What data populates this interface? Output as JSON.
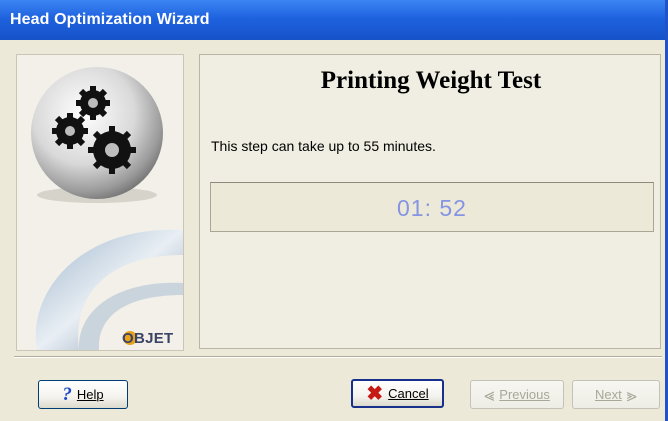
{
  "window": {
    "title": "Head Optimization Wizard"
  },
  "sidebar": {
    "logo_text": "OBJET"
  },
  "step": {
    "title": "Printing Weight Test",
    "description": "This step can take up to 55 minutes.",
    "timer": "01: 52"
  },
  "buttons": {
    "help": "Help",
    "cancel": "Cancel",
    "previous": "Previous",
    "next": "Next"
  },
  "colors": {
    "titlebar": "#1f62df",
    "timer_text": "#8594e3",
    "cancel_icon": "#c51a16",
    "help_icon": "#1b49c8"
  },
  "icons": {
    "help": "question-mark-icon",
    "cancel": "red-x-icon",
    "previous": "previous-arrow-icon",
    "next": "next-arrow-icon",
    "gears": "gears-icon"
  }
}
